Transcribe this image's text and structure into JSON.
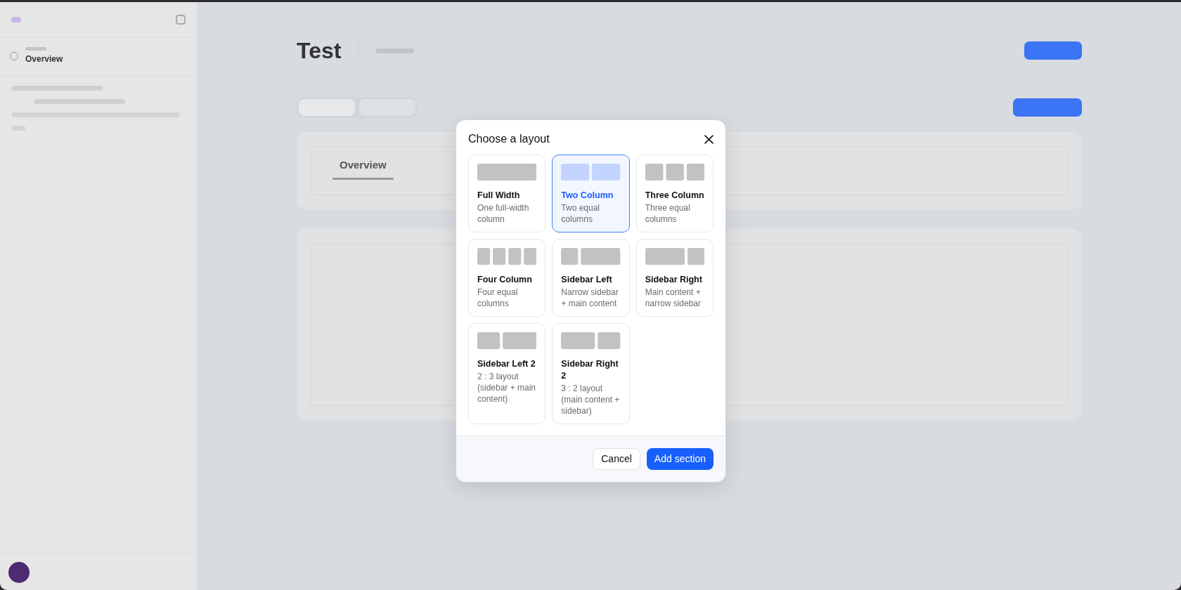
{
  "sidebar": {
    "section_title": "Overview"
  },
  "page": {
    "title": "Test",
    "tab": "Overview"
  },
  "dialog": {
    "title": "Choose a layout",
    "layouts": [
      {
        "kind": "full",
        "name": "Full Width",
        "description": "One full-width column",
        "selected": false
      },
      {
        "kind": "two",
        "name": "Two Column",
        "description": "Two equal columns",
        "selected": true
      },
      {
        "kind": "three",
        "name": "Three Column",
        "description": "Three equal columns",
        "selected": false
      },
      {
        "kind": "four",
        "name": "Four Column",
        "description": "Four equal columns",
        "selected": false
      },
      {
        "kind": "sidebar-left",
        "name": "Sidebar Left",
        "description": "Narrow sidebar + main content",
        "selected": false
      },
      {
        "kind": "sidebar-right",
        "name": "Sidebar Right",
        "description": "Main content + narrow sidebar",
        "selected": false
      },
      {
        "kind": "sidebar-left-2",
        "name": "Sidebar Left 2",
        "description": "2 : 3 layout (sidebar + main content)",
        "selected": false
      },
      {
        "kind": "sidebar-right-2",
        "name": "Sidebar Right 2",
        "description": "3 : 2 layout (main content + sidebar)",
        "selected": false
      }
    ],
    "buttons": {
      "cancel": "Cancel",
      "confirm": "Add section"
    }
  }
}
